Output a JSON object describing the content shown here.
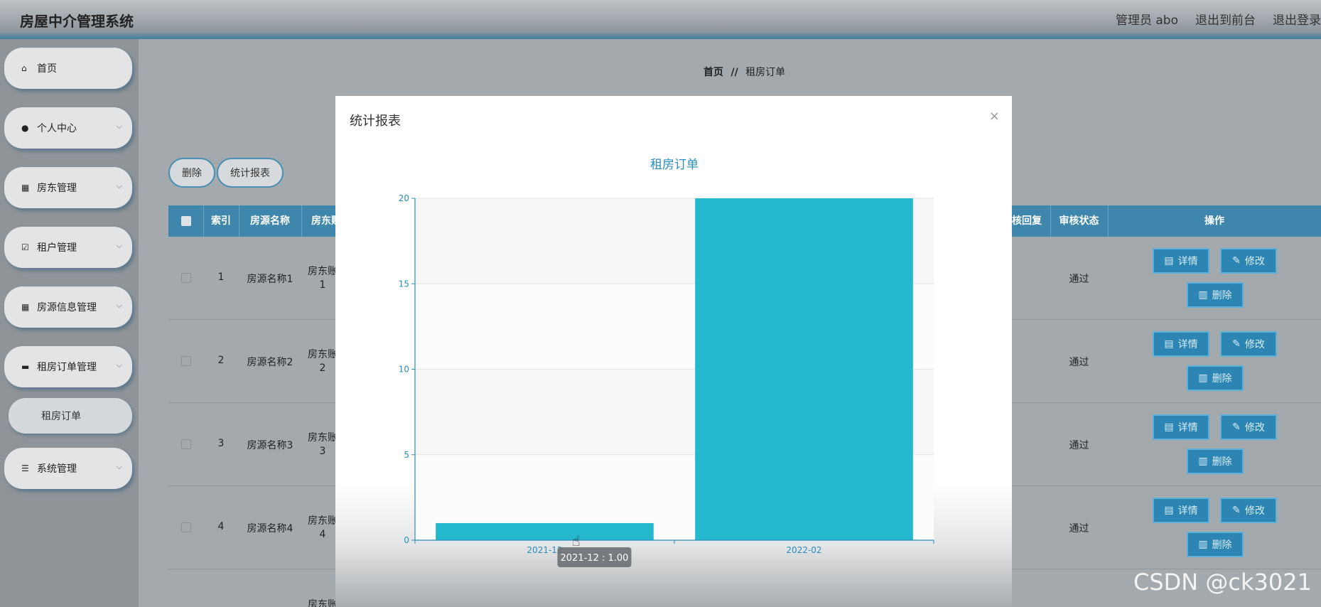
{
  "header": {
    "app_title": "房屋中介管理系统",
    "user_label": "管理员 abo",
    "back_to_front": "退出到前台",
    "logout": "退出登录"
  },
  "sidebar": {
    "items": [
      {
        "label": "首页",
        "icon": "home-icon",
        "has_chevron": false
      },
      {
        "label": "个人中心",
        "icon": "user-icon",
        "has_chevron": true
      },
      {
        "label": "房东管理",
        "icon": "grid-icon",
        "has_chevron": true
      },
      {
        "label": "租户管理",
        "icon": "check-square-icon",
        "has_chevron": true
      },
      {
        "label": "房源信息管理",
        "icon": "grid-icon",
        "has_chevron": true
      },
      {
        "label": "租房订单管理",
        "icon": "printer-icon",
        "has_chevron": true
      },
      {
        "label": "系统管理",
        "icon": "sliders-icon",
        "has_chevron": true
      }
    ],
    "subitem": "租房订单"
  },
  "breadcrumb": {
    "home": "首页",
    "separator": "//",
    "current": "租房订单"
  },
  "toolbar": {
    "delete": "删除",
    "report": "统计报表"
  },
  "table": {
    "headers": [
      "索引",
      "房源名称",
      "房东账",
      "核回复",
      "审核状态",
      "操作"
    ],
    "rows": [
      {
        "index": "1",
        "name": "房源名称1",
        "owner": "房东账",
        "owner2": "1",
        "status": "通过"
      },
      {
        "index": "2",
        "name": "房源名称2",
        "owner": "房东账",
        "owner2": "2",
        "status": "通过"
      },
      {
        "index": "3",
        "name": "房源名称3",
        "owner": "房东账",
        "owner2": "3",
        "status": "通过"
      },
      {
        "index": "4",
        "name": "房源名称4",
        "owner": "房东账",
        "owner2": "4",
        "status": "通过"
      },
      {
        "index": "",
        "name": "",
        "owner": "房东账",
        "owner2": "",
        "status": ""
      }
    ],
    "actions": {
      "detail": "详情",
      "edit": "修改",
      "delete": "删除"
    }
  },
  "modal": {
    "title": "统计报表",
    "close": "×"
  },
  "chart_data": {
    "type": "bar",
    "title": "租房订单",
    "categories": [
      "2021-12",
      "2022-02"
    ],
    "values": [
      1,
      20
    ],
    "ylim": [
      0,
      20
    ],
    "yticks": [
      0,
      5,
      10,
      15,
      20
    ],
    "tooltip": "2021-12 : 1.00",
    "bar_color": "#23b8cc",
    "axis_color": "#2a8dbe"
  },
  "watermark": "CSDN @ck3021",
  "colors": {
    "accent": "#2d85b3",
    "header": "#3f86ac"
  }
}
